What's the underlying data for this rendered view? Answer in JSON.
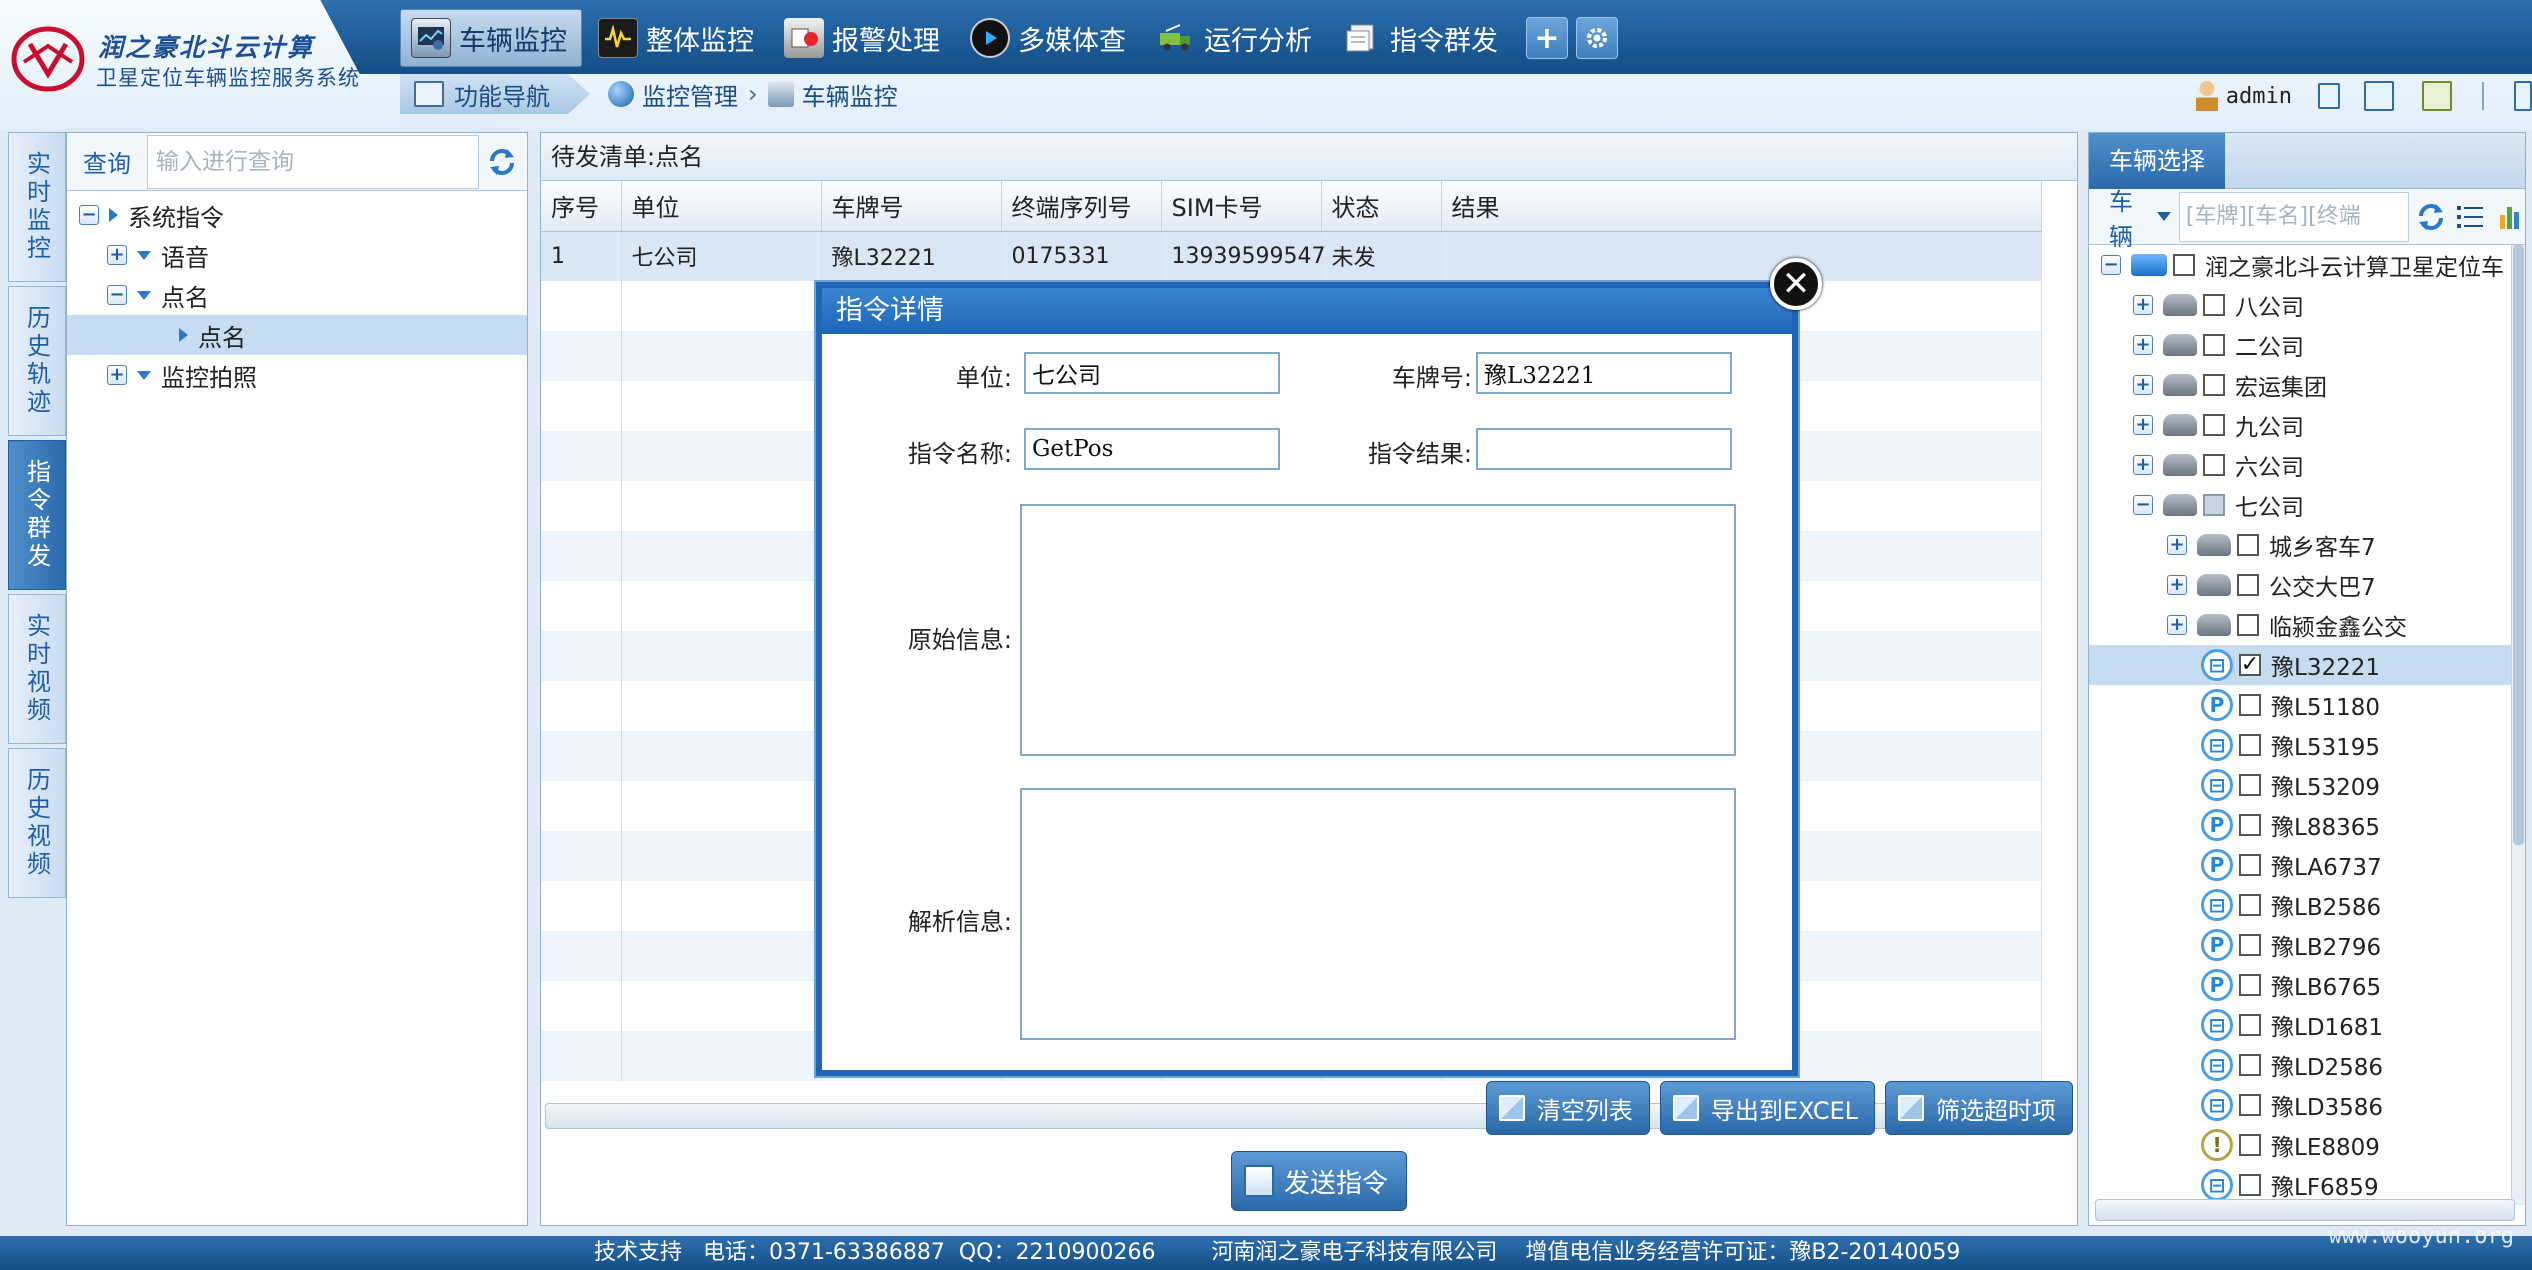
{
  "brand": {
    "line1": "润之豪北斗云计算",
    "line2": "卫星定位车辆监控服务系统"
  },
  "topnav": [
    {
      "label": "车辆监控",
      "active": true
    },
    {
      "label": "整体监控",
      "active": false
    },
    {
      "label": "报警处理",
      "active": false
    },
    {
      "label": "多媒体查",
      "active": false
    },
    {
      "label": "运行分析",
      "active": false
    },
    {
      "label": "指令群发",
      "active": false
    }
  ],
  "subbar": {
    "func_nav": "功能导航",
    "breadcrumb": [
      "监控管理",
      "车辆监控"
    ]
  },
  "user": {
    "name": "admin"
  },
  "vtabs": [
    {
      "label": "实时监控",
      "active": false
    },
    {
      "label": "历史轨迹",
      "active": false
    },
    {
      "label": "指令群发",
      "active": true
    },
    {
      "label": "实时视频",
      "active": false
    },
    {
      "label": "历史视频",
      "active": false
    }
  ],
  "left": {
    "search_label": "查询",
    "search_placeholder": "输入进行查询",
    "tree": {
      "root": "系统指令",
      "voice": "语音",
      "rollcall": "点名",
      "rollcall_child": "点名",
      "photo": "监控拍照"
    }
  },
  "center": {
    "title": "待发清单:点名",
    "columns": [
      "序号",
      "单位",
      "车牌号",
      "终端序列号",
      "SIM卡号",
      "状态",
      "结果"
    ],
    "rows": [
      [
        "1",
        "七公司",
        "豫L32221",
        "0175331",
        "13939599547",
        "未发",
        ""
      ]
    ],
    "buttons": {
      "clear": "清空列表",
      "export": "导出到EXCEL",
      "filter": "筛选超时项",
      "send": "发送指令"
    }
  },
  "modal": {
    "title": "指令详情",
    "unit_label": "单位:",
    "unit_value": "七公司",
    "plate_label": "车牌号:",
    "plate_value": "豫L32221",
    "cmd_name_label": "指令名称:",
    "cmd_name_value": "GetPos",
    "cmd_result_label": "指令结果:",
    "cmd_result_value": "",
    "raw_label": "原始信息:",
    "parsed_label": "解析信息:"
  },
  "right": {
    "tab": "车辆选择",
    "dropdown": "车辆",
    "search_placeholder": "[车牌][车名][终端",
    "root": "润之豪北斗云计算卫星定位车",
    "companies": [
      "八公司",
      "二公司",
      "宏运集团",
      "九公司",
      "六公司"
    ],
    "open_company": "七公司",
    "subgroups": [
      "城乡客车7",
      "公交大巴7",
      "临颍金鑫公交"
    ],
    "vehicles": [
      {
        "plate": "豫L32221",
        "icon": "bus",
        "checked": true
      },
      {
        "plate": "豫L51180",
        "icon": "parking",
        "checked": false
      },
      {
        "plate": "豫L53195",
        "icon": "bus",
        "checked": false
      },
      {
        "plate": "豫L53209",
        "icon": "bus",
        "checked": false
      },
      {
        "plate": "豫L88365",
        "icon": "parking",
        "checked": false
      },
      {
        "plate": "豫LA6737",
        "icon": "parking",
        "checked": false
      },
      {
        "plate": "豫LB2586",
        "icon": "bus",
        "checked": false
      },
      {
        "plate": "豫LB2796",
        "icon": "parking",
        "checked": false
      },
      {
        "plate": "豫LB6765",
        "icon": "parking",
        "checked": false
      },
      {
        "plate": "豫LD1681",
        "icon": "bus",
        "checked": false
      },
      {
        "plate": "豫LD2586",
        "icon": "bus",
        "checked": false
      },
      {
        "plate": "豫LD3586",
        "icon": "bus",
        "checked": false
      },
      {
        "plate": "豫LE8809",
        "icon": "alert",
        "checked": false
      },
      {
        "plate": "豫LF6859",
        "icon": "bus",
        "checked": false
      }
    ]
  },
  "footer": {
    "text": "技术支持   电话：0371-63386887  QQ：2210900266        河南润之豪电子科技有限公司    增值电信业务经营许可证：豫B2-20140059"
  },
  "watermark": "www.wooyun.org",
  "colors": {
    "header_blue": "#1b5a96",
    "accent": "#2a6aab",
    "modal_border": "#1f66b8"
  }
}
